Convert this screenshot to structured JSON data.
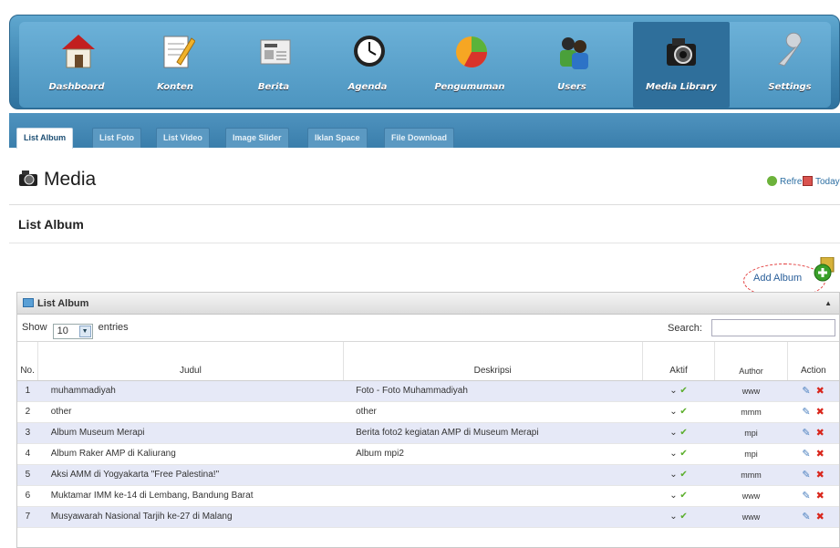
{
  "nav": {
    "items": [
      {
        "label": "Dashboard",
        "icon": "home-icon"
      },
      {
        "label": "Konten",
        "icon": "edit-document-icon"
      },
      {
        "label": "Berita",
        "icon": "newspaper-icon"
      },
      {
        "label": "Agenda",
        "icon": "clock-icon"
      },
      {
        "label": "Pengumuman",
        "icon": "pie-chart-icon"
      },
      {
        "label": "Users",
        "icon": "users-icon"
      },
      {
        "label": "Media Library",
        "icon": "camera-icon"
      },
      {
        "label": "Settings",
        "icon": "wrench-icon"
      }
    ],
    "active": "Media Library"
  },
  "tabs": [
    "List Album",
    "List Foto",
    "List Video",
    "Image Slider",
    "Iklan Space",
    "File Download"
  ],
  "page": {
    "title": "Media",
    "refresh_label": "Refresh",
    "today_label": "Today",
    "section_title": "List Album",
    "add_album_label": "Add Album"
  },
  "table": {
    "box_title": "List Album",
    "show_label": "Show",
    "entries_value": "10",
    "entries_label": "entries",
    "search_label": "Search:",
    "columns": [
      "No.",
      "Judul",
      "Deskripsi",
      "Aktif",
      "Author",
      "Action"
    ],
    "rows": [
      {
        "no": "1",
        "judul": "muhammadiyah",
        "deskripsi": "Foto - Foto Muhammadiyah",
        "author": "www"
      },
      {
        "no": "2",
        "judul": "other",
        "deskripsi": "other",
        "author": "mmm"
      },
      {
        "no": "3",
        "judul": "Album Museum Merapi",
        "deskripsi": "Berita foto2 kegiatan AMP di Museum Merapi",
        "author": "mpi"
      },
      {
        "no": "4",
        "judul": "Album Raker AMP di Kaliurang",
        "deskripsi": "Album mpi2",
        "author": "mpi"
      },
      {
        "no": "5",
        "judul": "Aksi AMM di Yogyakarta \"Free Palestina!\"",
        "deskripsi": "",
        "author": "mmm"
      },
      {
        "no": "6",
        "judul": "Muktamar IMM ke-14 di Lembang, Bandung Barat",
        "deskripsi": "",
        "author": "www"
      },
      {
        "no": "7",
        "judul": "Musyawarah Nasional Tarjih ke-27 di Malang",
        "deskripsi": "",
        "author": "www"
      }
    ]
  }
}
